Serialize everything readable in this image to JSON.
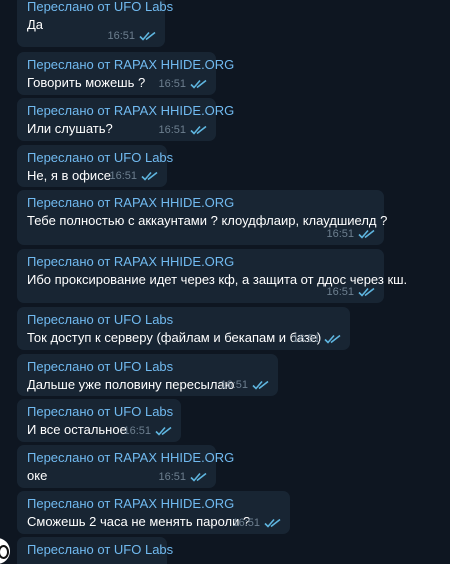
{
  "messages": [
    {
      "forwarded_prefix": "Переслано от",
      "source": "UFO Labs",
      "text": "Да",
      "time": "16:51",
      "status": "read"
    },
    {
      "forwarded_prefix": "Переслано от",
      "source": "RAPAX HHIDE.ORG",
      "text": "Говорить можешь ?",
      "time": "16:51",
      "status": "read"
    },
    {
      "forwarded_prefix": "Переслано от",
      "source": "RAPAX HHIDE.ORG",
      "text": "Или слушать?",
      "time": "16:51",
      "status": "read"
    },
    {
      "forwarded_prefix": "Переслано от",
      "source": "UFO Labs",
      "text": "Не, я в офисе",
      "time": "16:51",
      "status": "read"
    },
    {
      "forwarded_prefix": "Переслано от",
      "source": "RAPAX HHIDE.ORG",
      "text": "Тебе полностью с аккаунтами ? клоудфлаир, клаудшиелд ?",
      "time": "16:51",
      "status": "read"
    },
    {
      "forwarded_prefix": "Переслано от",
      "source": "RAPAX HHIDE.ORG",
      "text": "Ибо проксирование идет через кф, а защита от ддос через кш.",
      "time": "16:51",
      "status": "read"
    },
    {
      "forwarded_prefix": "Переслано от",
      "source": "UFO Labs",
      "text": "Ток доступ к серверу (файлам и бекапам и базе)",
      "time": "16:51",
      "status": "read"
    },
    {
      "forwarded_prefix": "Переслано от",
      "source": "UFO Labs",
      "text": "Дальше уже половину пересылаю",
      "time": "16:51",
      "status": "read"
    },
    {
      "forwarded_prefix": "Переслано от",
      "source": "UFO Labs",
      "text": "И все остальное",
      "time": "16:51",
      "status": "read"
    },
    {
      "forwarded_prefix": "Переслано от",
      "source": "RAPAX HHIDE.ORG",
      "text": "оке",
      "time": "16:51",
      "status": "read"
    },
    {
      "forwarded_prefix": "Переслано от",
      "source": "RAPAX HHIDE.ORG",
      "text": "Сможешь 2 часа не менять пароли ?",
      "time": "16:51",
      "status": "read"
    },
    {
      "forwarded_prefix": "Переслано от",
      "source": "UFO Labs",
      "text": "",
      "time": "",
      "status": ""
    }
  ],
  "colors": {
    "background": "#0e1621",
    "bubble": "#182533",
    "forward_header": "#71baf0",
    "text": "#ffffff",
    "time": "#6d7f8f",
    "read_ticks": "#5fb6e0"
  },
  "icons": {
    "read_status": "double-check-icon",
    "avatar": "user-avatar-icon"
  }
}
